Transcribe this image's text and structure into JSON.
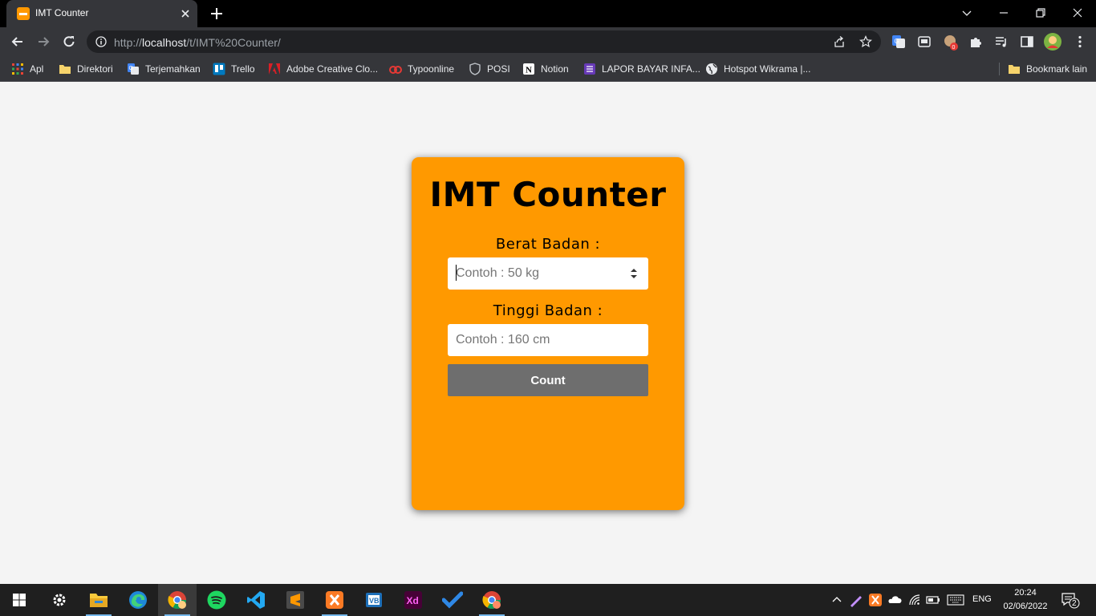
{
  "browser": {
    "tab_title": "IMT Counter",
    "url_prefix": "http://",
    "url_host": "localhost",
    "url_path": "/t/IMT%20Counter/"
  },
  "bookmarks": [
    {
      "label": "Apl",
      "icon": "apps-grid-icon",
      "color": "#f4b400"
    },
    {
      "label": "Direktori",
      "icon": "folder-icon",
      "color": "#f6d36b"
    },
    {
      "label": "Terjemahkan",
      "icon": "google-translate-icon",
      "color": "#4285f4"
    },
    {
      "label": "Trello",
      "icon": "trello-icon",
      "color": "#0079bf"
    },
    {
      "label": "Adobe Creative Clo...",
      "icon": "adobe-icon",
      "color": "#da1f26"
    },
    {
      "label": "Typoonline",
      "icon": "typoonline-icon",
      "color": "#e53935"
    },
    {
      "label": "POSI",
      "icon": "posi-icon",
      "color": "#9aa0a6"
    },
    {
      "label": "Notion",
      "icon": "notion-icon",
      "color": "#ffffff"
    },
    {
      "label": "LAPOR BAYAR INFA...",
      "icon": "form-icon",
      "color": "#673ab7"
    },
    {
      "label": "Hotspot Wikrama |...",
      "icon": "globe-icon",
      "color": "#e8eaed"
    }
  ],
  "bookmarks_other": "Bookmark lain",
  "app": {
    "title": "IMT Counter",
    "weight_label": "Berat Badan :",
    "weight_placeholder": "Contoh : 50 kg",
    "height_label": "Tinggi Badan :",
    "height_placeholder": "Contoh : 160 cm",
    "count_label": "Count"
  },
  "taskbar": {
    "lang": "ENG",
    "time": "20:24",
    "date": "02/06/2022",
    "notifications": "2"
  }
}
